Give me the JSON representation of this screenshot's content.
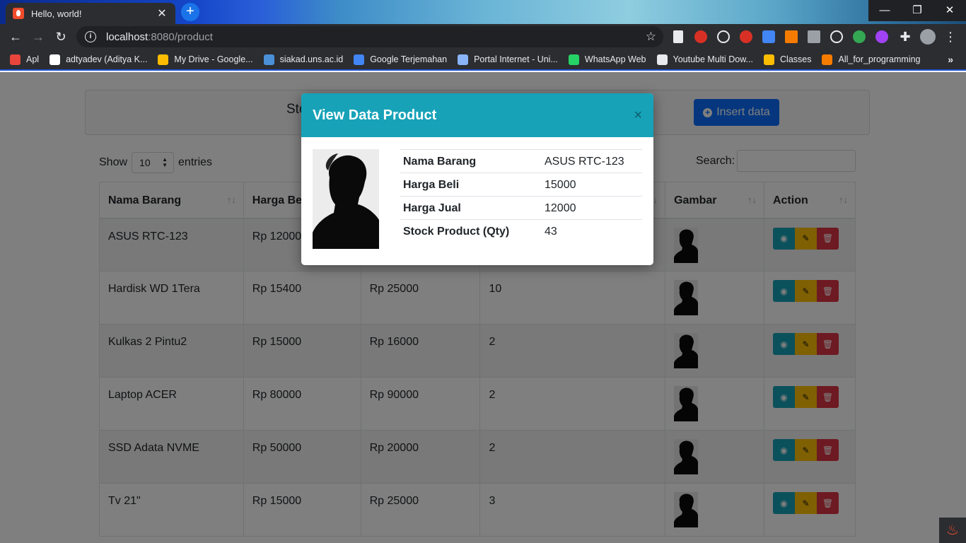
{
  "browser": {
    "tab_title": "Hello, world!",
    "url_host": "localhost",
    "url_path": ":8080/product",
    "bookmarks": [
      {
        "label": "Apl",
        "color": "#e8453c"
      },
      {
        "label": "adtyadev (Aditya K...",
        "color": "#ffffff"
      },
      {
        "label": "My Drive - Google...",
        "color": "#fbbc04"
      },
      {
        "label": "siakad.uns.ac.id",
        "color": "#4a90d9"
      },
      {
        "label": "Google Terjemahan",
        "color": "#4285f4"
      },
      {
        "label": "Portal Internet - Uni...",
        "color": "#8ab4f8"
      },
      {
        "label": "WhatsApp Web",
        "color": "#25d366"
      },
      {
        "label": "Youtube Multi Dow...",
        "color": "#e8eaed"
      },
      {
        "label": "Classes",
        "color": "#fbbc04"
      },
      {
        "label": "All_for_programming",
        "color": "#f57c00"
      }
    ]
  },
  "page": {
    "card_title": "Sto",
    "insert_label": "Insert data",
    "show_label": "Show",
    "entries_value": "10",
    "entries_label": "entries",
    "search_label": "Search:",
    "columns": [
      "Nama Barang",
      "Harga Be",
      "",
      "",
      "Gambar",
      "Action"
    ],
    "rows": [
      {
        "name": "ASUS RTC-123",
        "beli": "Rp 12000",
        "jual": "",
        "qty": ""
      },
      {
        "name": "Hardisk WD 1Tera",
        "beli": "Rp 15400",
        "jual": "Rp 25000",
        "qty": "10"
      },
      {
        "name": "Kulkas 2 Pintu2",
        "beli": "Rp 15000",
        "jual": "Rp 16000",
        "qty": "2"
      },
      {
        "name": "Laptop ACER",
        "beli": "Rp 80000",
        "jual": "Rp 90000",
        "qty": "2"
      },
      {
        "name": "SSD Adata NVME",
        "beli": "Rp 50000",
        "jual": "Rp 20000",
        "qty": "2"
      },
      {
        "name": "Tv 21\"",
        "beli": "Rp 15000",
        "jual": "Rp 25000",
        "qty": "3"
      }
    ]
  },
  "modal": {
    "title": "View Data Product",
    "close": "×",
    "fields": [
      {
        "label": "Nama Barang",
        "value": "ASUS RTC-123"
      },
      {
        "label": "Harga Beli",
        "value": "15000"
      },
      {
        "label": "Harga Jual",
        "value": "12000"
      },
      {
        "label": "Stock Product (Qty)",
        "value": "43"
      }
    ]
  },
  "colors": {
    "primary": "#0d6efd",
    "info": "#17a2b8",
    "warning": "#ffc107",
    "danger": "#dc3545"
  }
}
